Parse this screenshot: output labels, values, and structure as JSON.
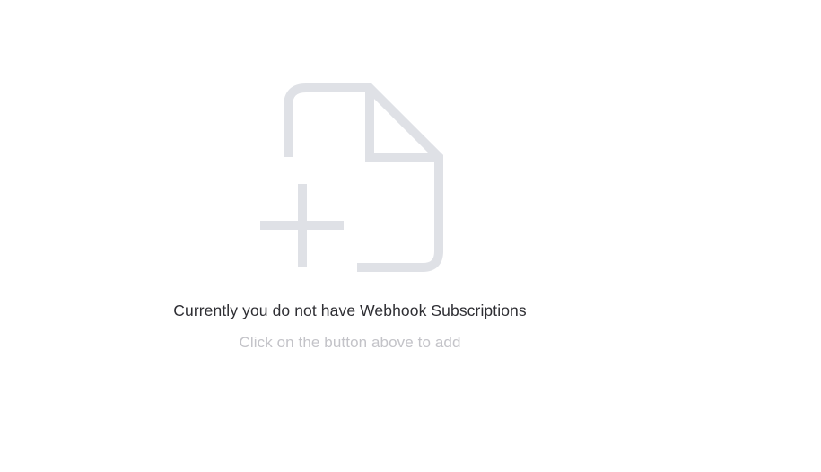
{
  "empty_state": {
    "icon": "add-file-icon",
    "icon_color": "#dfe1e6",
    "title": "Currently you do not have Webhook Subscriptions",
    "subtitle": "Click on the button above to add"
  }
}
